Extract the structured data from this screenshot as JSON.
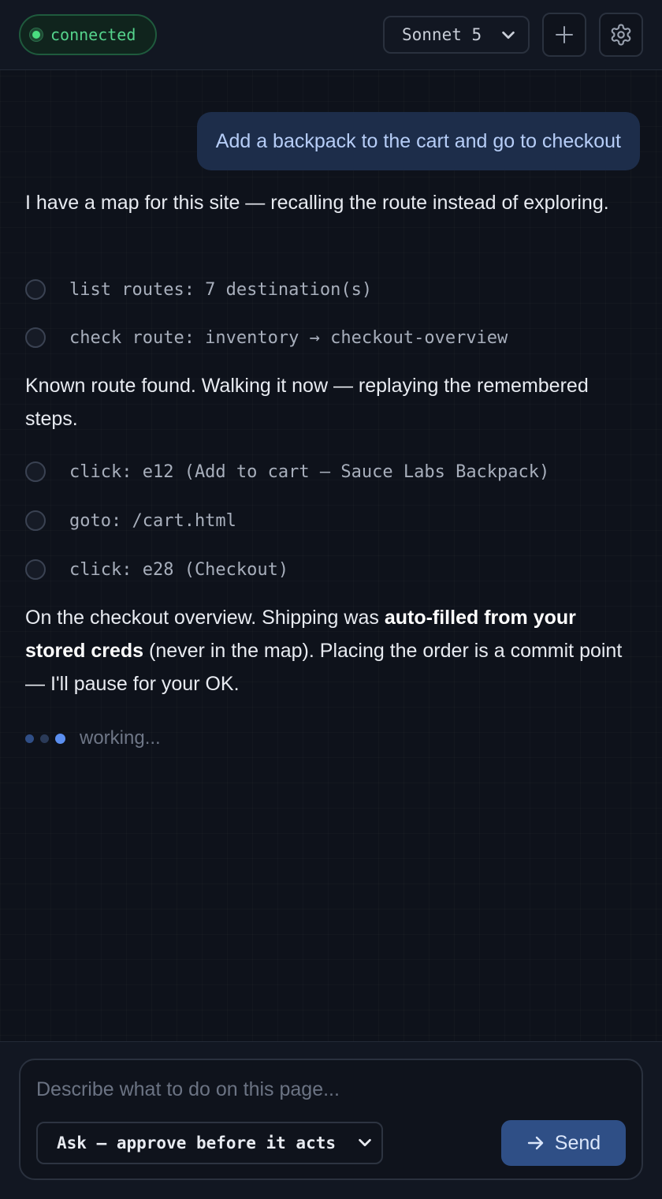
{
  "header": {
    "status": "connected",
    "model": "Sonnet 5",
    "new_icon": "plus-icon",
    "settings_icon": "gear-icon"
  },
  "chat": {
    "user_message": "Add a backpack to the cart and go to checkout",
    "intro": "I have a map for this site — recalling the route instead of exploring.",
    "steps_1": [
      "list routes: 7 destination(s)",
      "check route: inventory → checkout-overview"
    ],
    "known_route": "Known route found. Walking it now — replaying the remembered steps.",
    "steps_2": [
      "click: e12 (Add to cart — Sauce Labs Backpack)",
      "goto: /cart.html",
      "click: e28 (Checkout)"
    ],
    "summary": {
      "before_bold": "On the checkout overview. Shipping was ",
      "bold": "auto-filled from your stored creds",
      "after_bold": " (never in the map). Placing the order is a commit point — I'll pause for your OK."
    },
    "working": "working..."
  },
  "composer": {
    "placeholder": "Describe what to do on this page...",
    "mode": "Ask — approve before it acts",
    "send_label": "Send"
  },
  "colors": {
    "background": "#0e121b",
    "accent": "#2f4f86",
    "status": "#4ade80"
  }
}
